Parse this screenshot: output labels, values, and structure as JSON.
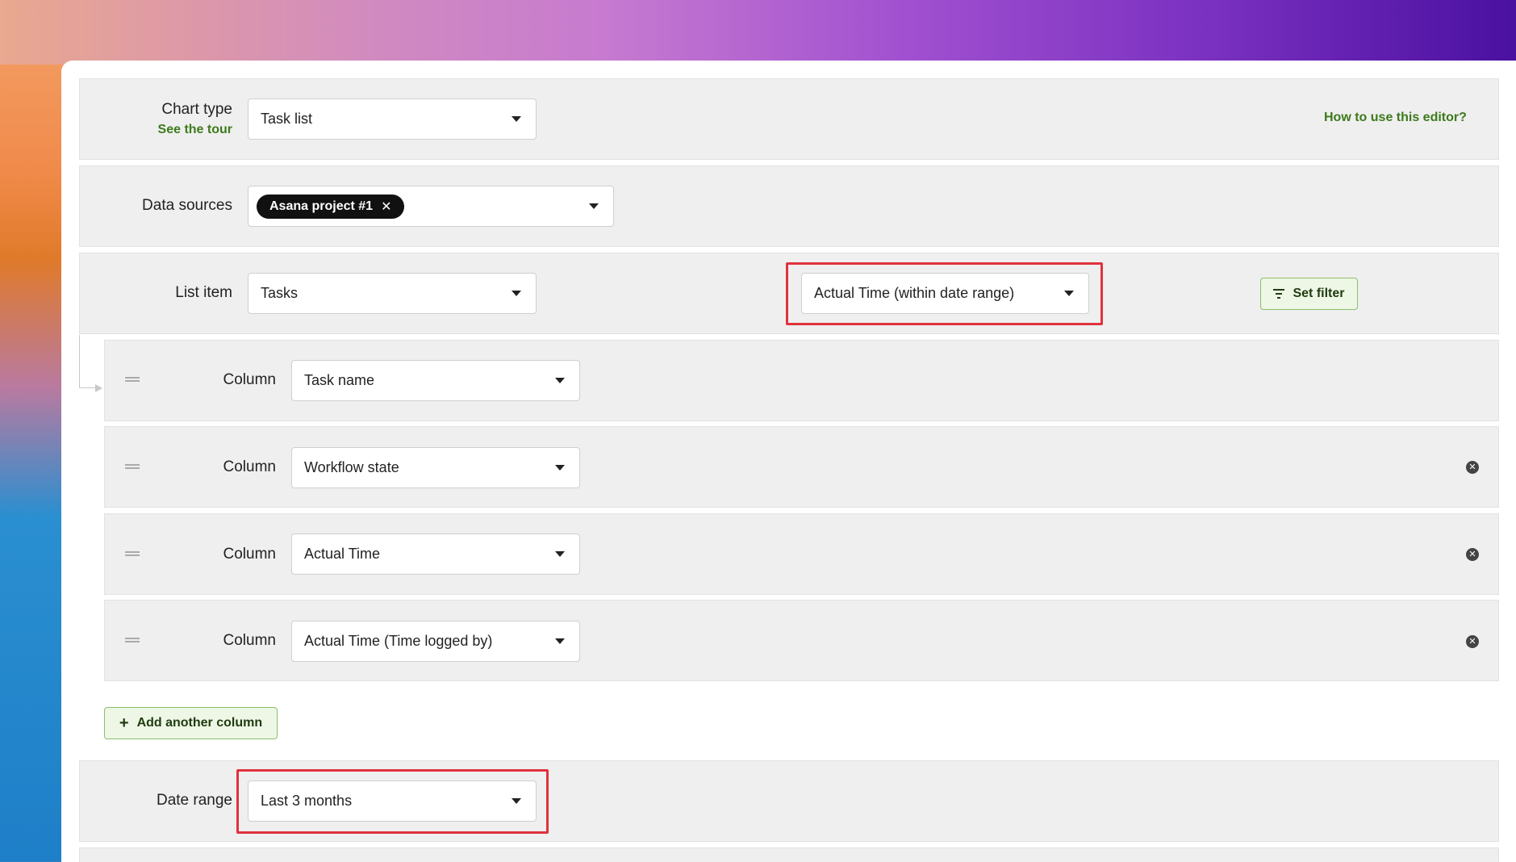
{
  "chart_type": {
    "label": "Chart type",
    "tour_link": "See the tour",
    "value": "Task list",
    "help_link": "How to use this editor?"
  },
  "data_sources": {
    "label": "Data sources",
    "chip": "Asana project #1",
    "chip_remove": "✕"
  },
  "list_item": {
    "label": "List item",
    "value": "Tasks",
    "filter_field": "Actual Time (within date range)",
    "set_filter": "Set filter"
  },
  "columns": [
    {
      "label": "Column",
      "value": "Task name"
    },
    {
      "label": "Column",
      "value": "Workflow state"
    },
    {
      "label": "Column",
      "value": "Actual Time"
    },
    {
      "label": "Column",
      "value": "Actual Time (Time logged by)"
    }
  ],
  "add_column": "Add another column",
  "date_range": {
    "label": "Date range",
    "value": "Last 3 months"
  },
  "colors": {
    "accent_green": "#3d7a1c",
    "highlight_red": "#e0323d"
  }
}
